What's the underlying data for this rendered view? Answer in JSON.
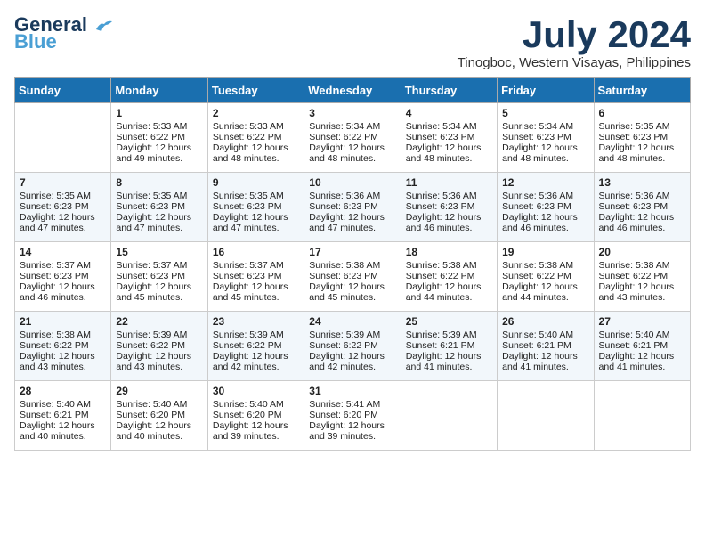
{
  "header": {
    "logo_line1": "General",
    "logo_line2": "Blue",
    "month": "July 2024",
    "location": "Tinogboc, Western Visayas, Philippines"
  },
  "columns": [
    "Sunday",
    "Monday",
    "Tuesday",
    "Wednesday",
    "Thursday",
    "Friday",
    "Saturday"
  ],
  "weeks": [
    [
      {
        "day": "",
        "sunrise": "",
        "sunset": "",
        "daylight": ""
      },
      {
        "day": "1",
        "sunrise": "Sunrise: 5:33 AM",
        "sunset": "Sunset: 6:22 PM",
        "daylight": "Daylight: 12 hours and 49 minutes."
      },
      {
        "day": "2",
        "sunrise": "Sunrise: 5:33 AM",
        "sunset": "Sunset: 6:22 PM",
        "daylight": "Daylight: 12 hours and 48 minutes."
      },
      {
        "day": "3",
        "sunrise": "Sunrise: 5:34 AM",
        "sunset": "Sunset: 6:22 PM",
        "daylight": "Daylight: 12 hours and 48 minutes."
      },
      {
        "day": "4",
        "sunrise": "Sunrise: 5:34 AM",
        "sunset": "Sunset: 6:23 PM",
        "daylight": "Daylight: 12 hours and 48 minutes."
      },
      {
        "day": "5",
        "sunrise": "Sunrise: 5:34 AM",
        "sunset": "Sunset: 6:23 PM",
        "daylight": "Daylight: 12 hours and 48 minutes."
      },
      {
        "day": "6",
        "sunrise": "Sunrise: 5:35 AM",
        "sunset": "Sunset: 6:23 PM",
        "daylight": "Daylight: 12 hours and 48 minutes."
      }
    ],
    [
      {
        "day": "7",
        "sunrise": "Sunrise: 5:35 AM",
        "sunset": "Sunset: 6:23 PM",
        "daylight": "Daylight: 12 hours and 47 minutes."
      },
      {
        "day": "8",
        "sunrise": "Sunrise: 5:35 AM",
        "sunset": "Sunset: 6:23 PM",
        "daylight": "Daylight: 12 hours and 47 minutes."
      },
      {
        "day": "9",
        "sunrise": "Sunrise: 5:35 AM",
        "sunset": "Sunset: 6:23 PM",
        "daylight": "Daylight: 12 hours and 47 minutes."
      },
      {
        "day": "10",
        "sunrise": "Sunrise: 5:36 AM",
        "sunset": "Sunset: 6:23 PM",
        "daylight": "Daylight: 12 hours and 47 minutes."
      },
      {
        "day": "11",
        "sunrise": "Sunrise: 5:36 AM",
        "sunset": "Sunset: 6:23 PM",
        "daylight": "Daylight: 12 hours and 46 minutes."
      },
      {
        "day": "12",
        "sunrise": "Sunrise: 5:36 AM",
        "sunset": "Sunset: 6:23 PM",
        "daylight": "Daylight: 12 hours and 46 minutes."
      },
      {
        "day": "13",
        "sunrise": "Sunrise: 5:36 AM",
        "sunset": "Sunset: 6:23 PM",
        "daylight": "Daylight: 12 hours and 46 minutes."
      }
    ],
    [
      {
        "day": "14",
        "sunrise": "Sunrise: 5:37 AM",
        "sunset": "Sunset: 6:23 PM",
        "daylight": "Daylight: 12 hours and 46 minutes."
      },
      {
        "day": "15",
        "sunrise": "Sunrise: 5:37 AM",
        "sunset": "Sunset: 6:23 PM",
        "daylight": "Daylight: 12 hours and 45 minutes."
      },
      {
        "day": "16",
        "sunrise": "Sunrise: 5:37 AM",
        "sunset": "Sunset: 6:23 PM",
        "daylight": "Daylight: 12 hours and 45 minutes."
      },
      {
        "day": "17",
        "sunrise": "Sunrise: 5:38 AM",
        "sunset": "Sunset: 6:23 PM",
        "daylight": "Daylight: 12 hours and 45 minutes."
      },
      {
        "day": "18",
        "sunrise": "Sunrise: 5:38 AM",
        "sunset": "Sunset: 6:22 PM",
        "daylight": "Daylight: 12 hours and 44 minutes."
      },
      {
        "day": "19",
        "sunrise": "Sunrise: 5:38 AM",
        "sunset": "Sunset: 6:22 PM",
        "daylight": "Daylight: 12 hours and 44 minutes."
      },
      {
        "day": "20",
        "sunrise": "Sunrise: 5:38 AM",
        "sunset": "Sunset: 6:22 PM",
        "daylight": "Daylight: 12 hours and 43 minutes."
      }
    ],
    [
      {
        "day": "21",
        "sunrise": "Sunrise: 5:38 AM",
        "sunset": "Sunset: 6:22 PM",
        "daylight": "Daylight: 12 hours and 43 minutes."
      },
      {
        "day": "22",
        "sunrise": "Sunrise: 5:39 AM",
        "sunset": "Sunset: 6:22 PM",
        "daylight": "Daylight: 12 hours and 43 minutes."
      },
      {
        "day": "23",
        "sunrise": "Sunrise: 5:39 AM",
        "sunset": "Sunset: 6:22 PM",
        "daylight": "Daylight: 12 hours and 42 minutes."
      },
      {
        "day": "24",
        "sunrise": "Sunrise: 5:39 AM",
        "sunset": "Sunset: 6:22 PM",
        "daylight": "Daylight: 12 hours and 42 minutes."
      },
      {
        "day": "25",
        "sunrise": "Sunrise: 5:39 AM",
        "sunset": "Sunset: 6:21 PM",
        "daylight": "Daylight: 12 hours and 41 minutes."
      },
      {
        "day": "26",
        "sunrise": "Sunrise: 5:40 AM",
        "sunset": "Sunset: 6:21 PM",
        "daylight": "Daylight: 12 hours and 41 minutes."
      },
      {
        "day": "27",
        "sunrise": "Sunrise: 5:40 AM",
        "sunset": "Sunset: 6:21 PM",
        "daylight": "Daylight: 12 hours and 41 minutes."
      }
    ],
    [
      {
        "day": "28",
        "sunrise": "Sunrise: 5:40 AM",
        "sunset": "Sunset: 6:21 PM",
        "daylight": "Daylight: 12 hours and 40 minutes."
      },
      {
        "day": "29",
        "sunrise": "Sunrise: 5:40 AM",
        "sunset": "Sunset: 6:20 PM",
        "daylight": "Daylight: 12 hours and 40 minutes."
      },
      {
        "day": "30",
        "sunrise": "Sunrise: 5:40 AM",
        "sunset": "Sunset: 6:20 PM",
        "daylight": "Daylight: 12 hours and 39 minutes."
      },
      {
        "day": "31",
        "sunrise": "Sunrise: 5:41 AM",
        "sunset": "Sunset: 6:20 PM",
        "daylight": "Daylight: 12 hours and 39 minutes."
      },
      {
        "day": "",
        "sunrise": "",
        "sunset": "",
        "daylight": ""
      },
      {
        "day": "",
        "sunrise": "",
        "sunset": "",
        "daylight": ""
      },
      {
        "day": "",
        "sunrise": "",
        "sunset": "",
        "daylight": ""
      }
    ]
  ]
}
